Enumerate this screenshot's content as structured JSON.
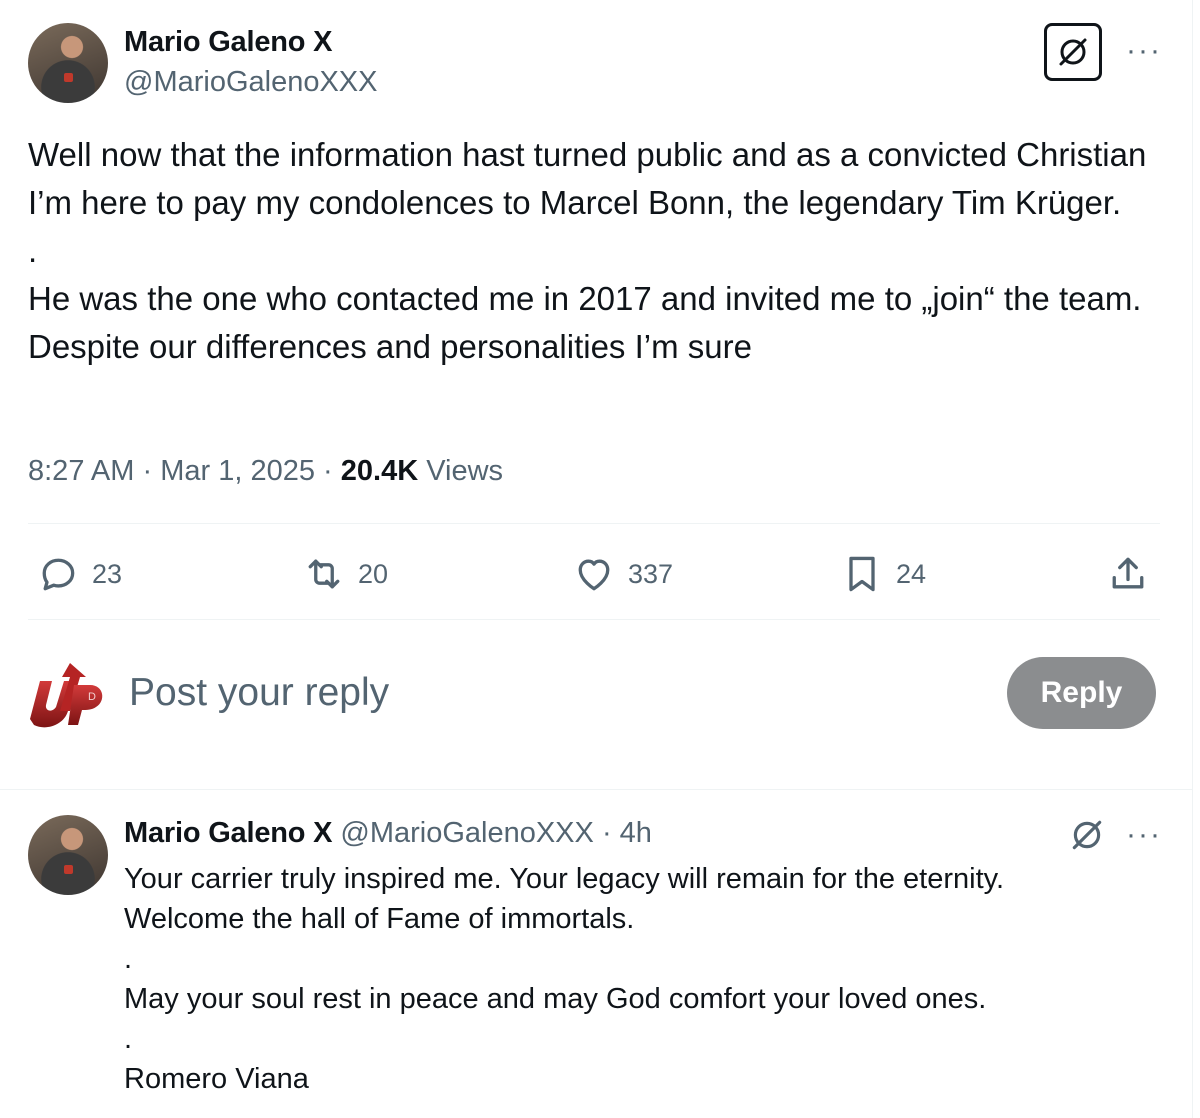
{
  "post": {
    "author_name": "Mario Galeno X",
    "author_handle": "@MarioGalenoXXX",
    "text": "Well now that the information hast turned public and as a convicted Christian I’m here to pay my condolences to Marcel Bonn, the legendary Tim Krüger.\n.\nHe was the one who contacted me in 2017 and invited me to „join“ the team. Despite our differences and personalities I’m sure",
    "time": "8:27 AM",
    "date": "Mar 1, 2025",
    "separator": "·",
    "views_count": "20.4K",
    "views_label": "Views",
    "more_label": "···"
  },
  "actions": {
    "replies": "23",
    "reposts": "20",
    "likes": "337",
    "bookmarks": "24"
  },
  "composer": {
    "avatar_letter": "D",
    "placeholder": "Post your reply",
    "reply_label": "Reply"
  },
  "reply": {
    "author_name": "Mario Galeno X",
    "author_handle": "@MarioGalenoXXX",
    "separator": "·",
    "age": "4h",
    "text": "Your carrier truly inspired me. Your legacy will remain for the eternity.\nWelcome the hall of Fame of immortals.\n.\nMay your soul rest in peace and may God comfort your loved ones.\n.\nRomero Viana",
    "more_label": "···"
  },
  "colors": {
    "text": "#0f1419",
    "secondary": "#536471",
    "divider": "#eff3f4",
    "reply_button": "#8b8d8f",
    "logo_red": "#a51d1d"
  },
  "icons": [
    "grok-icon",
    "more-icon",
    "reply-icon",
    "repost-icon",
    "like-icon",
    "bookmark-icon",
    "share-icon"
  ]
}
